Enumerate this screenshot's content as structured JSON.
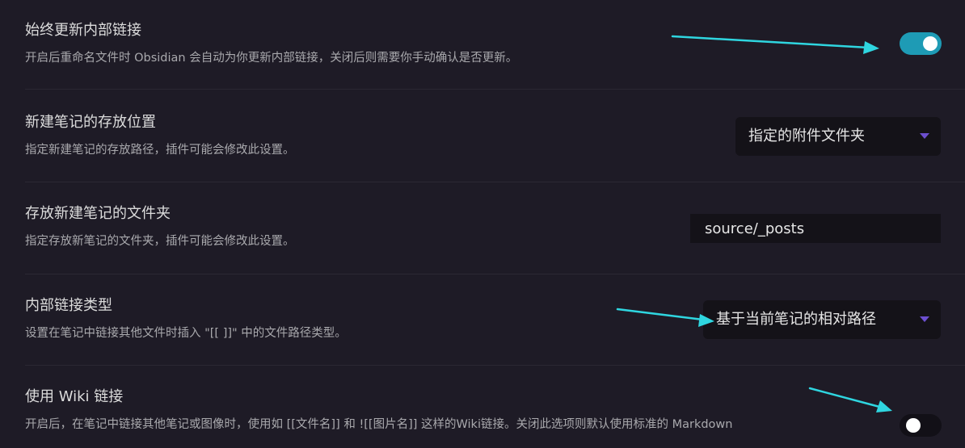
{
  "settings": {
    "always_update_links": {
      "title": "始终更新内部链接",
      "desc": "开启后重命名文件时 Obsidian 会自动为你更新内部链接，关闭后则需要你手动确认是否更新。",
      "enabled": true
    },
    "new_note_location": {
      "title": "新建笔记的存放位置",
      "desc": "指定新建笔记的存放路径，插件可能会修改此设置。",
      "selected": "指定的附件文件夹"
    },
    "new_note_folder": {
      "title": "存放新建笔记的文件夹",
      "desc": "指定存放新笔记的文件夹，插件可能会修改此设置。",
      "value": "source/_posts"
    },
    "link_format": {
      "title": "内部链接类型",
      "desc": "设置在笔记中链接其他文件时插入 \"[[ ]]\" 中的文件路径类型。",
      "selected": "基于当前笔记的相对路径"
    },
    "use_wiki_links": {
      "title": "使用 Wiki 链接",
      "desc": "开启后，在笔记中链接其他笔记或图像时，使用如 [[文件名]] 和 ![[图片名]] 这样的Wiki链接。关闭此选项则默认使用标准的 Markdown",
      "enabled": false
    }
  },
  "colors": {
    "background": "#1e1b26",
    "toggle_on": "#1e9bb5",
    "accent_caret": "#6c4fd0",
    "annotation_arrow": "#2fd6e0"
  }
}
